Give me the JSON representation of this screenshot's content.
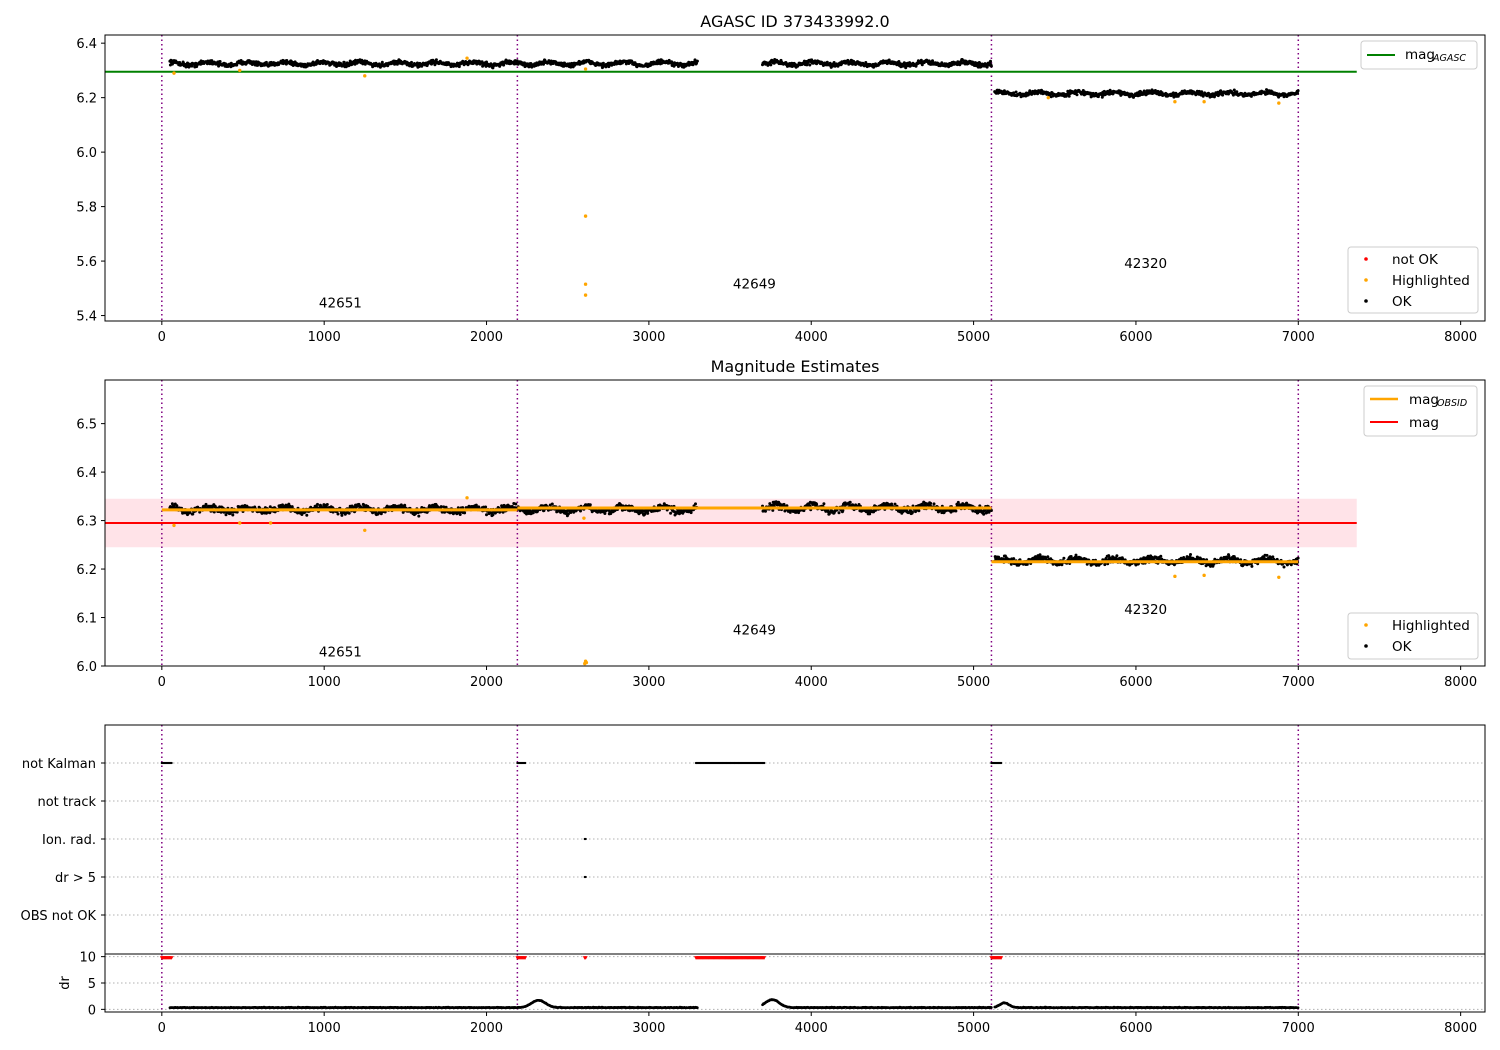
{
  "figure": {
    "colors": {
      "ok": "#000000",
      "highlighted": "#ffa500",
      "not_ok": "#ff0000",
      "agasc": "#008000",
      "mag": "#ff0000",
      "obsid": "#ffa500",
      "band": "#ffc0cb",
      "boundary": "#800080"
    }
  },
  "chart_data": [
    {
      "type": "scatter",
      "title": "AGASC ID 373433992.0",
      "xlim": [
        -350,
        8150
      ],
      "ylim": [
        5.38,
        6.43
      ],
      "xticks": [
        0,
        1000,
        2000,
        3000,
        4000,
        5000,
        6000,
        7000,
        8000
      ],
      "yticks": [
        5.4,
        5.6,
        5.8,
        6.0,
        6.2,
        6.4
      ],
      "x_tick_labels": [
        "0",
        "1000",
        "2000",
        "3000",
        "4000",
        "5000",
        "6000",
        "7000",
        "8000"
      ],
      "y_tick_labels": [
        "5.4",
        "5.6",
        "5.8",
        "6.0",
        "6.2",
        "6.4"
      ],
      "legends": [
        {
          "position": "top-right",
          "entries": [
            {
              "name": "mag",
              "sub": "AGASC",
              "kind": "line",
              "color": "#008000"
            }
          ]
        },
        {
          "position": "bottom-right",
          "entries": [
            {
              "name": "not OK",
              "kind": "dot",
              "color": "#ff0000"
            },
            {
              "name": "Highlighted",
              "kind": "dot",
              "color": "#ffa500"
            },
            {
              "name": "OK",
              "kind": "dot",
              "color": "#000000"
            }
          ]
        }
      ],
      "reference_lines": [
        {
          "name": "mag_AGASC",
          "y": 6.295,
          "x_range": [
            -350,
            7360
          ],
          "color": "#008000"
        }
      ],
      "vlines": [
        0,
        2190,
        5110,
        7000
      ],
      "observations": [
        {
          "label": "42651",
          "x": 1100,
          "y": 5.43
        },
        {
          "label": "42649",
          "x": 3650,
          "y": 5.5
        },
        {
          "label": "42320",
          "x": 6060,
          "y": 5.575
        }
      ],
      "ok_segments": [
        {
          "x_range": [
            50,
            3300
          ],
          "mean": 6.325,
          "spread": 0.012
        },
        {
          "x_range": [
            3700,
            5110
          ],
          "mean": 6.325,
          "spread": 0.012
        },
        {
          "x_range": [
            5130,
            7000
          ],
          "mean": 6.215,
          "spread": 0.012
        }
      ],
      "highlighted_points": [
        [
          75,
          6.29
        ],
        [
          480,
          6.3
        ],
        [
          1250,
          6.28
        ],
        [
          1880,
          6.345
        ],
        [
          2610,
          6.305
        ],
        [
          2610,
          5.765
        ],
        [
          2610,
          5.515
        ],
        [
          2610,
          5.475
        ],
        [
          6240,
          6.185
        ],
        [
          6420,
          6.185
        ],
        [
          6880,
          6.18
        ],
        [
          5460,
          6.2
        ]
      ]
    },
    {
      "type": "scatter",
      "title": "Magnitude Estimates",
      "xlim": [
        -350,
        8150
      ],
      "ylim": [
        6.0,
        6.59
      ],
      "xticks": [
        0,
        1000,
        2000,
        3000,
        4000,
        5000,
        6000,
        7000,
        8000
      ],
      "yticks": [
        6.0,
        6.1,
        6.2,
        6.3,
        6.4,
        6.5
      ],
      "x_tick_labels": [
        "0",
        "1000",
        "2000",
        "3000",
        "4000",
        "5000",
        "6000",
        "7000",
        "8000"
      ],
      "y_tick_labels": [
        "6.0",
        "6.1",
        "6.2",
        "6.3",
        "6.4",
        "6.5"
      ],
      "legends": [
        {
          "position": "top-right",
          "entries": [
            {
              "name": "mag",
              "sub": "OBSID",
              "kind": "line",
              "color": "#ffa500"
            },
            {
              "name": "mag",
              "sub": "",
              "kind": "line",
              "color": "#ff0000"
            }
          ]
        },
        {
          "position": "bottom-right",
          "entries": [
            {
              "name": "Highlighted",
              "kind": "dot",
              "color": "#ffa500"
            },
            {
              "name": "OK",
              "kind": "dot",
              "color": "#000000"
            }
          ]
        }
      ],
      "band": {
        "y_range": [
          6.245,
          6.345
        ],
        "x_range": [
          -350,
          7360
        ]
      },
      "reference_lines": [
        {
          "name": "mag",
          "y": 6.295,
          "x_range": [
            -350,
            7360
          ],
          "color": "#ff0000"
        }
      ],
      "obsid_lines": [
        {
          "x_range": [
            0,
            2190
          ],
          "y": 6.322
        },
        {
          "x_range": [
            2190,
            5110
          ],
          "y": 6.326
        },
        {
          "x_range": [
            5110,
            7000
          ],
          "y": 6.215
        }
      ],
      "vlines": [
        0,
        2190,
        5110,
        7000
      ],
      "observations": [
        {
          "label": "42651",
          "x": 1100,
          "y": 6.02
        },
        {
          "label": "42649",
          "x": 3650,
          "y": 6.065
        },
        {
          "label": "42320",
          "x": 6060,
          "y": 6.107
        }
      ],
      "ok_segments": [
        {
          "x_range": [
            50,
            3300
          ],
          "mean": 6.323,
          "spread": 0.01
        },
        {
          "x_range": [
            3700,
            5110
          ],
          "mean": 6.326,
          "spread": 0.011
        },
        {
          "x_range": [
            5130,
            7000
          ],
          "mean": 6.217,
          "spread": 0.01
        }
      ],
      "highlighted_points": [
        [
          75,
          6.29
        ],
        [
          480,
          6.295
        ],
        [
          670,
          6.295
        ],
        [
          1250,
          6.28
        ],
        [
          1880,
          6.347
        ],
        [
          2600,
          6.305
        ],
        [
          2610,
          6.01
        ],
        [
          2605,
          6.005
        ],
        [
          2615,
          6.007
        ],
        [
          6240,
          6.185
        ],
        [
          6420,
          6.187
        ],
        [
          6880,
          6.183
        ]
      ]
    },
    {
      "type": "scatter",
      "title": "",
      "xlim": [
        -350,
        8150
      ],
      "categories": [
        "not Kalman",
        "not track",
        "Ion. rad.",
        "dr > 5",
        "OBS not OK"
      ],
      "flags": [
        {
          "category": "not Kalman",
          "ranges": [
            [
              0,
              60
            ],
            [
              2190,
              2240
            ],
            [
              3290,
              3710
            ],
            [
              5110,
              5170
            ]
          ]
        },
        {
          "category": "not track",
          "ranges": []
        },
        {
          "category": "Ion. rad.",
          "ranges": [
            [
              2605,
              2615
            ]
          ]
        },
        {
          "category": "dr > 5",
          "ranges": [
            [
              2605,
              2615
            ]
          ]
        },
        {
          "category": "OBS not OK",
          "ranges": []
        }
      ],
      "vlines": [
        0,
        2190,
        5110,
        7000
      ]
    },
    {
      "type": "scatter",
      "title": "",
      "ylabel": "dr",
      "xlim": [
        -350,
        8150
      ],
      "ylim": [
        -0.5,
        10.5
      ],
      "xticks": [
        0,
        1000,
        2000,
        3000,
        4000,
        5000,
        6000,
        7000,
        8000
      ],
      "yticks": [
        0,
        5,
        10
      ],
      "x_tick_labels": [
        "0",
        "1000",
        "2000",
        "3000",
        "4000",
        "5000",
        "6000",
        "7000",
        "8000"
      ],
      "y_tick_labels": [
        "0",
        "5",
        "10"
      ],
      "capped_ranges": [
        [
          0,
          60
        ],
        [
          2190,
          2240
        ],
        [
          2605,
          2615
        ],
        [
          3290,
          3710
        ],
        [
          5110,
          5170
        ]
      ],
      "cap_value": 9.8,
      "dr_segments": [
        {
          "x_range": [
            50,
            3300
          ],
          "mean": 0.3,
          "spread": 0.15
        },
        {
          "x_range": [
            3700,
            5110
          ],
          "mean": 0.3,
          "spread": 0.15
        },
        {
          "x_range": [
            5130,
            7000
          ],
          "mean": 0.3,
          "spread": 0.15
        }
      ],
      "dr_bumps": [
        {
          "x": 2320,
          "height": 1.4,
          "width": 60
        },
        {
          "x": 3760,
          "height": 1.5,
          "width": 60
        },
        {
          "x": 5190,
          "height": 0.9,
          "width": 40
        }
      ],
      "vlines": [
        0,
        2190,
        5110,
        7000
      ]
    }
  ]
}
